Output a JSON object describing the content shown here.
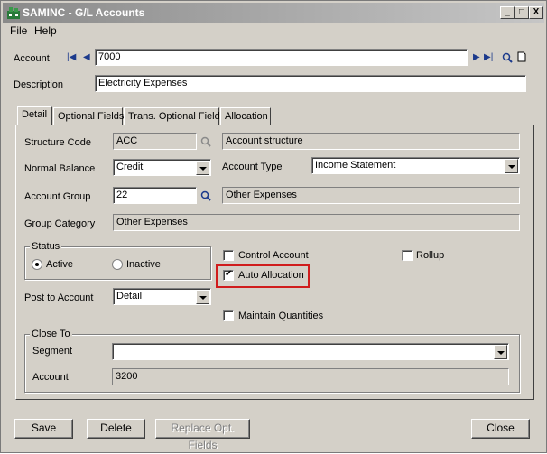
{
  "window": {
    "title": "SAMINC - G/L Accounts",
    "min": "_",
    "max": "□",
    "close": "X"
  },
  "menu": {
    "file": "File",
    "help": "Help"
  },
  "header": {
    "account_label": "Account",
    "account_value": "7000",
    "description_label": "Description",
    "description_value": "Electricity Expenses"
  },
  "tabs": [
    "Detail",
    "Optional Fields",
    "Trans. Optional Fields",
    "Allocation"
  ],
  "detail": {
    "structure_code_label": "Structure Code",
    "structure_code_value": "ACC",
    "structure_desc": "Account structure",
    "normal_balance_label": "Normal Balance",
    "normal_balance_value": "Credit",
    "account_type_label": "Account Type",
    "account_type_value": "Income Statement",
    "account_group_label": "Account Group",
    "account_group_value": "22",
    "account_group_desc": "Other Expenses",
    "group_category_label": "Group Category",
    "group_category_value": "Other Expenses",
    "status_label": "Status",
    "status_active": "Active",
    "status_inactive": "Inactive",
    "status_selected": "Active",
    "control_account_label": "Control Account",
    "control_account_checked": false,
    "rollup_label": "Rollup",
    "rollup_checked": false,
    "auto_allocation_label": "Auto Allocation",
    "auto_allocation_checked": true,
    "post_to_account_label": "Post to Account",
    "post_to_account_value": "Detail",
    "maintain_quantities_label": "Maintain Quantities",
    "maintain_quantities_checked": false,
    "close_to_label": "Close To",
    "segment_label": "Segment",
    "segment_value": "",
    "close_account_label": "Account",
    "close_account_value": "3200"
  },
  "buttons": {
    "save": "Save",
    "delete": "Delete",
    "replace_opt_fields": "Replace Opt. Fields",
    "close": "Close"
  },
  "colors": {
    "highlight": "#d01c1c",
    "nav_arrows": "#1c3a8c"
  }
}
